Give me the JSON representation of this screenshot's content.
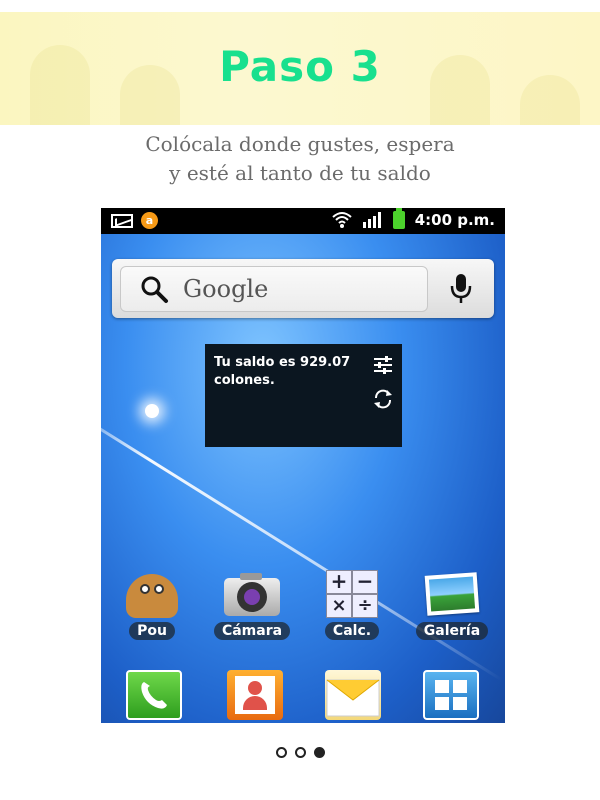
{
  "header": {
    "title": "Paso 3"
  },
  "subtitle": {
    "line1": "Colócala donde gustes, espera",
    "line2": "y esté al tanto de tu saldo"
  },
  "phone": {
    "statusbar": {
      "time": "4:00 p.m.",
      "notification_letter": "a"
    },
    "search": {
      "brand": "Google"
    },
    "widget": {
      "balance_text": "Tu saldo es 929.07 colones."
    },
    "apps": [
      {
        "label": "Pou"
      },
      {
        "label": "Cámara"
      },
      {
        "label": "Calc."
      },
      {
        "label": "Galería"
      }
    ]
  },
  "pager": {
    "total": 3,
    "active_index": 2
  },
  "colors": {
    "title": "#18e08e",
    "header_bg": "#fbf6c0",
    "subtitle": "#6b6b6b"
  }
}
